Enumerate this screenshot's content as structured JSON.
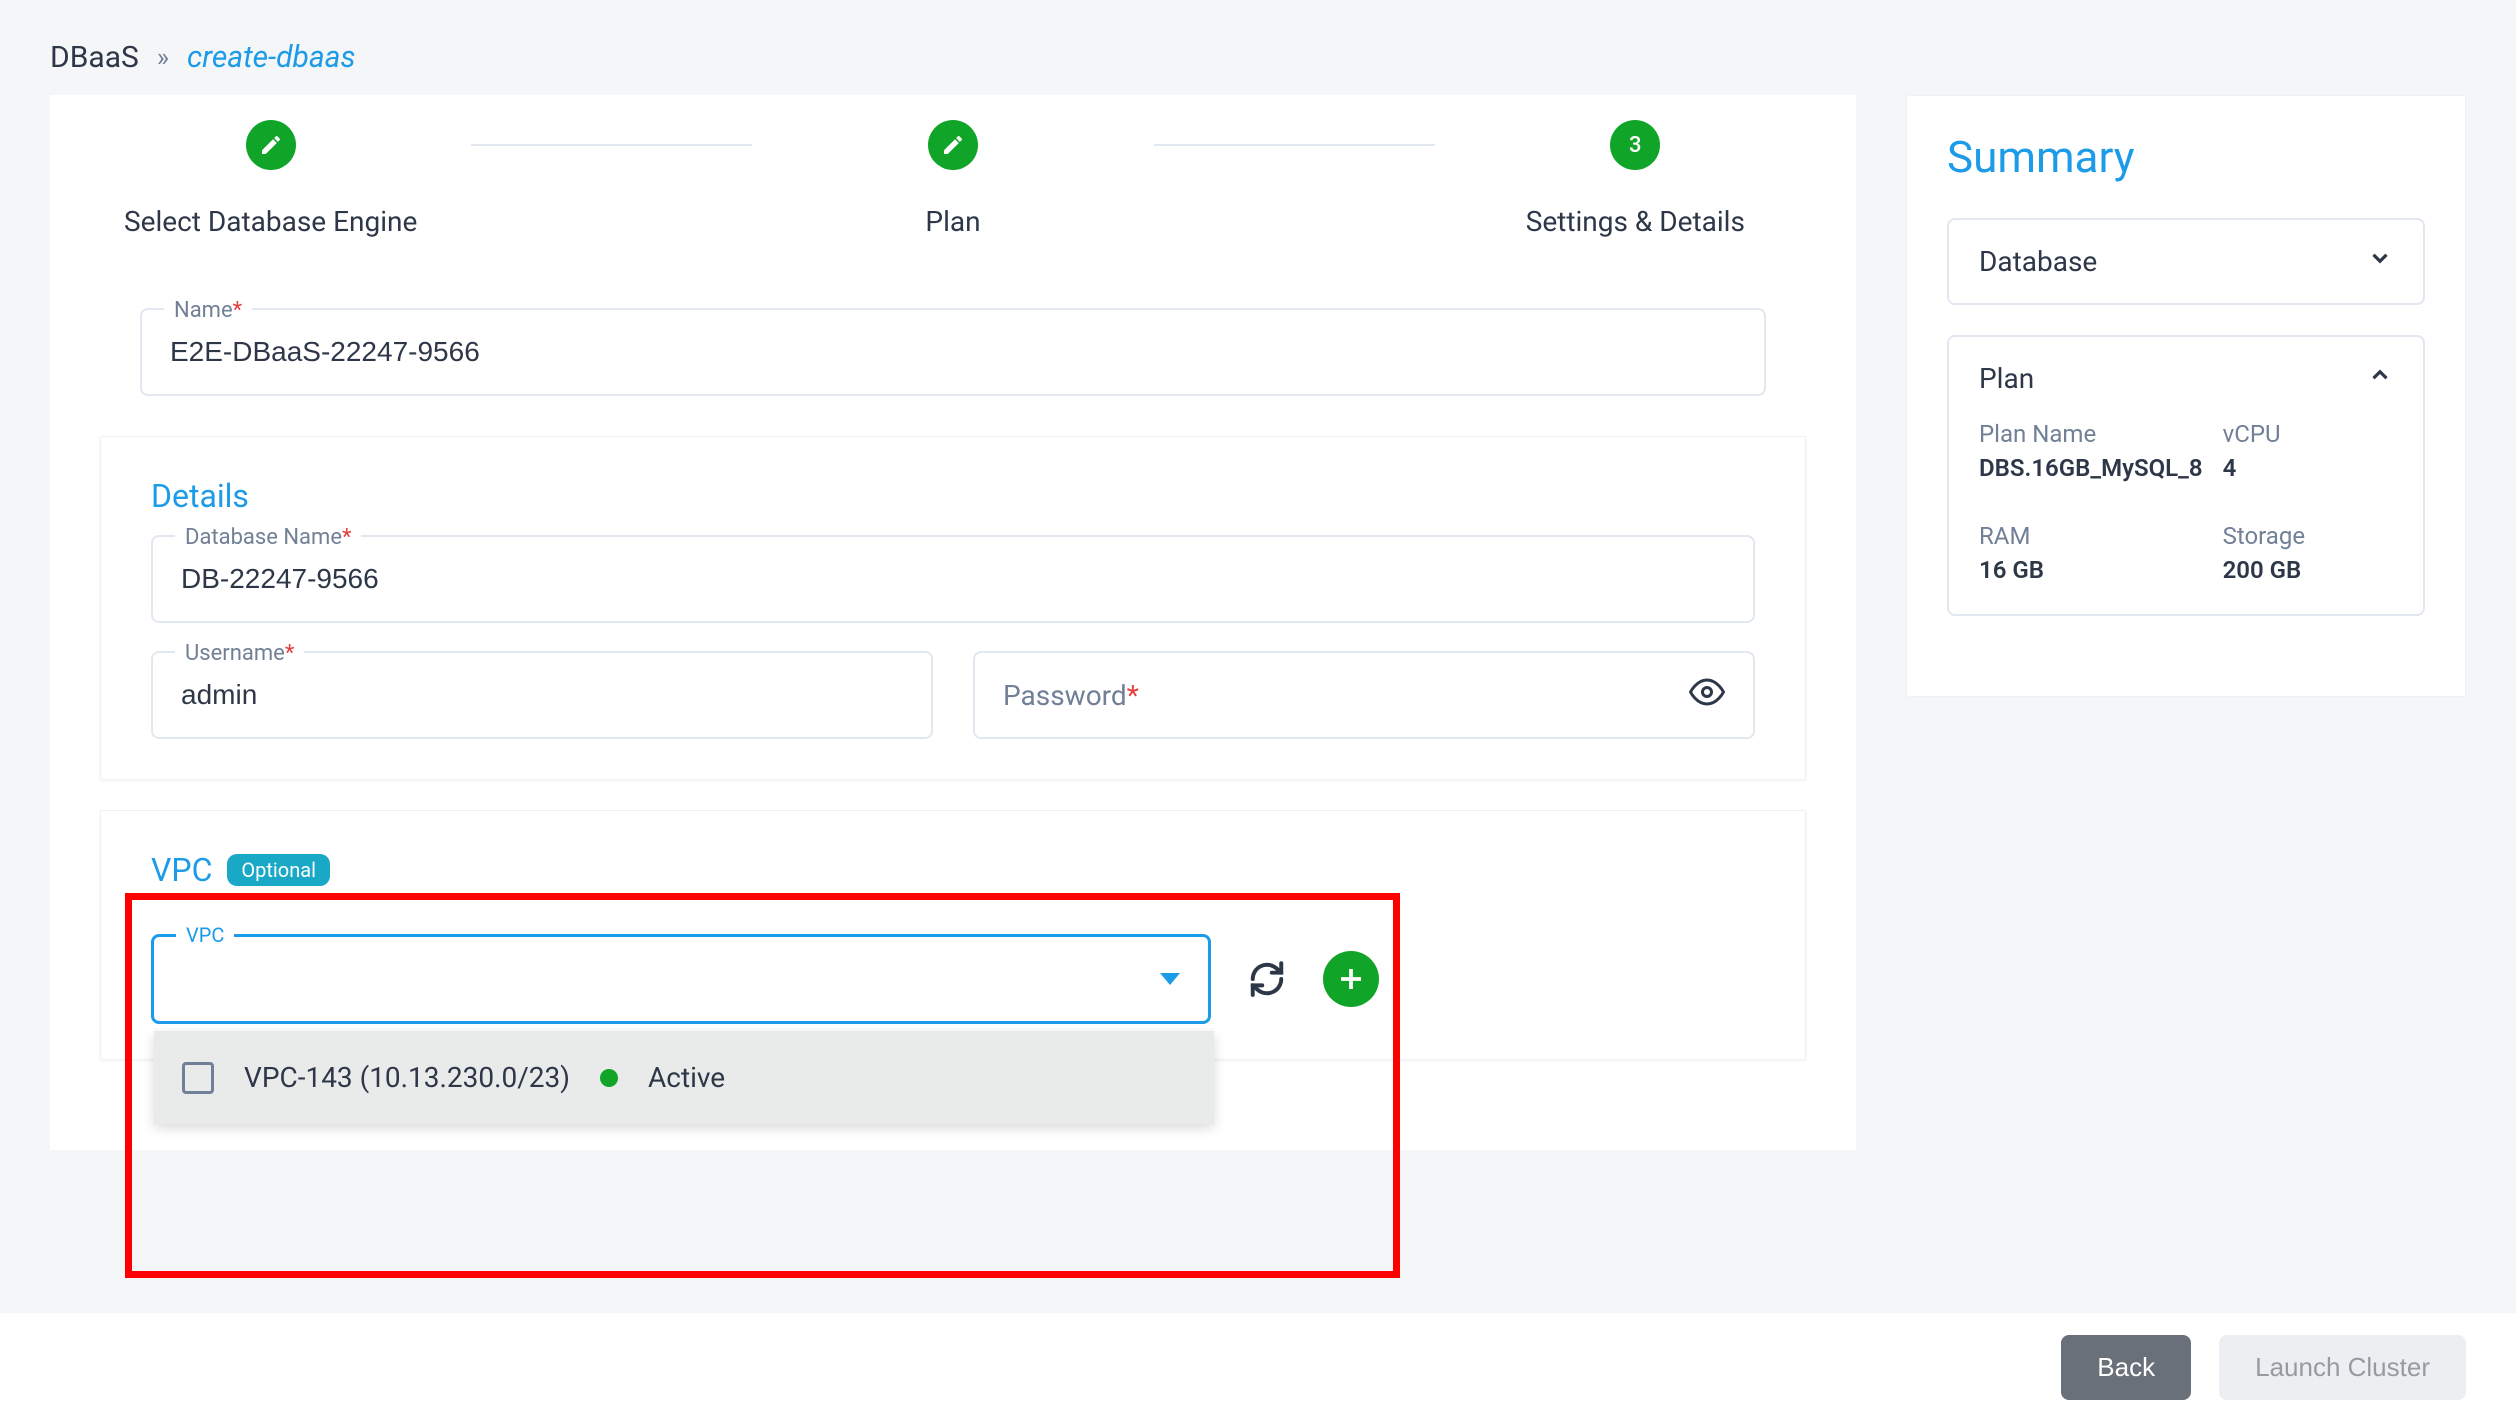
{
  "breadcrumb": {
    "root": "DBaaS",
    "sep": "»",
    "leaf": "create-dbaas"
  },
  "stepper": {
    "step1_label": "Select Database Engine",
    "step2_label": "Plan",
    "step3_num": "3",
    "step3_label": "Settings & Details"
  },
  "name_field": {
    "label": "Name",
    "value": "E2E-DBaaS-22247-9566"
  },
  "details": {
    "title": "Details",
    "db_name_label": "Database Name",
    "db_name_value": "DB-22247-9566",
    "username_label": "Username",
    "username_value": "admin",
    "password_placeholder": "Password"
  },
  "vpc": {
    "title": "VPC",
    "badge": "Optional",
    "field_label": "VPC",
    "option_label": "VPC-143 (10.13.230.0/23)",
    "option_status": "Active"
  },
  "summary": {
    "title": "Summary",
    "database_header": "Database",
    "plan_header": "Plan",
    "plan_name_label": "Plan Name",
    "plan_name_value": "DBS.16GB_MySQL_8",
    "vcpu_label": "vCPU",
    "vcpu_value": "4",
    "ram_label": "RAM",
    "ram_value": "16 GB",
    "storage_label": "Storage",
    "storage_value": "200 GB"
  },
  "footer": {
    "back": "Back",
    "launch": "Launch Cluster"
  }
}
